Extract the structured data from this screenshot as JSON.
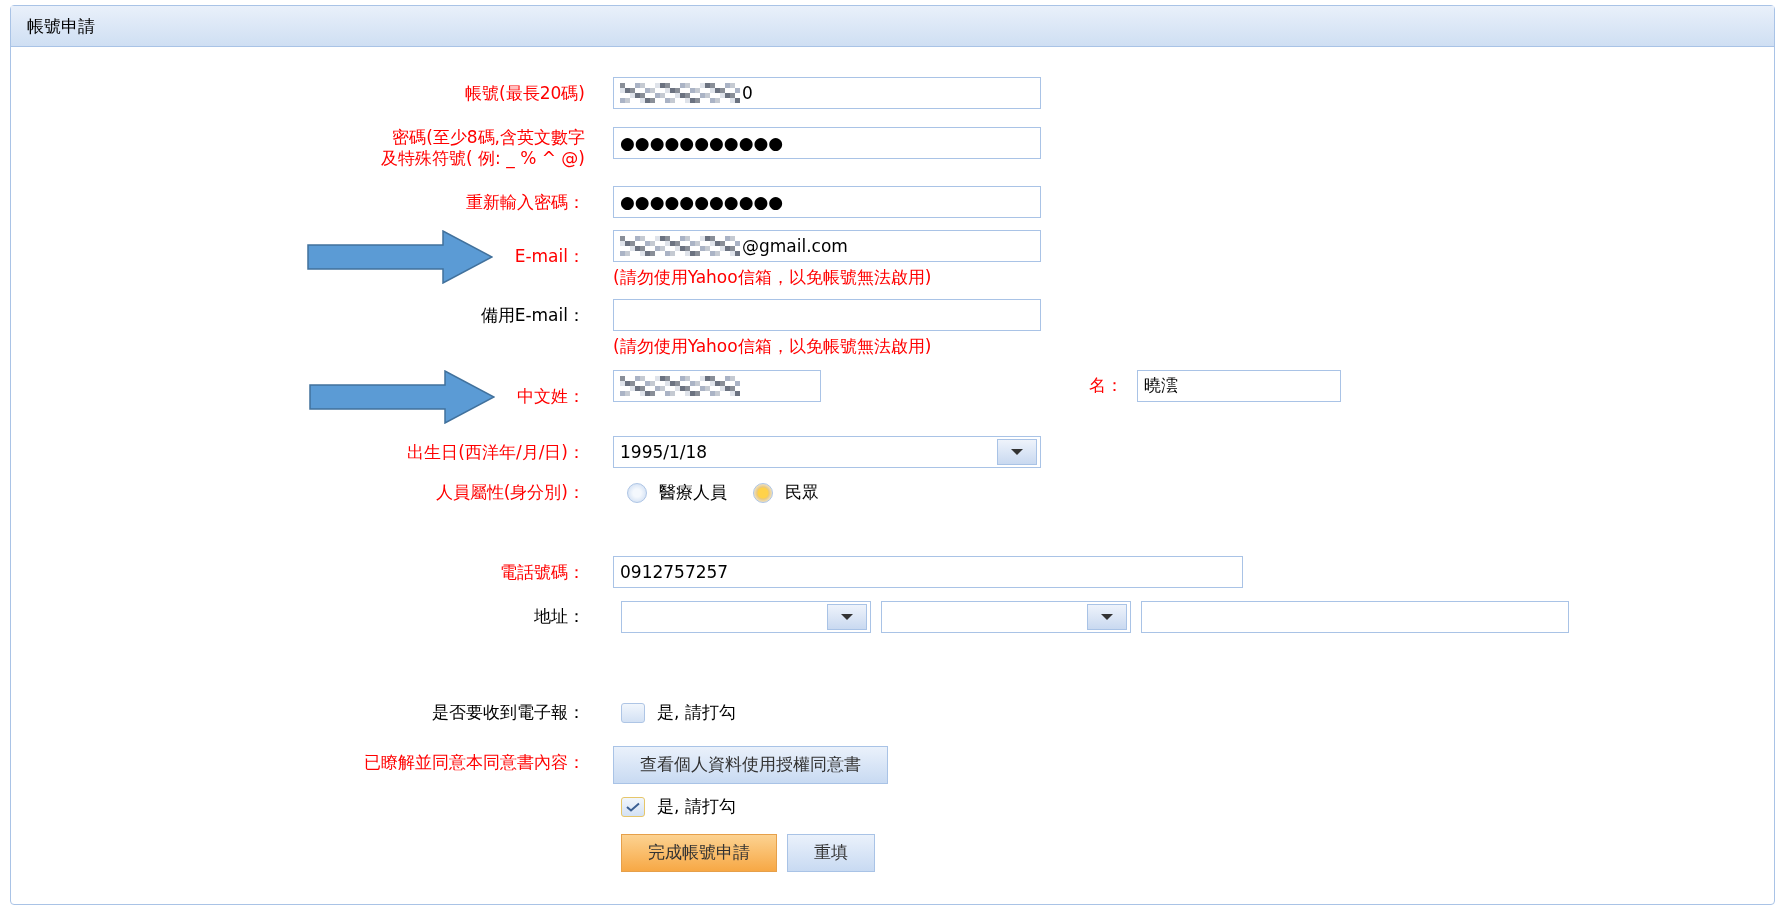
{
  "panel": {
    "title": "帳號申請"
  },
  "fields": [
    {
      "kind": "text",
      "label": "帳號(最長20碼)",
      "required": true,
      "arrow": false,
      "redacted": true,
      "value": "0"
    },
    {
      "kind": "text",
      "label": "密碼(至少8碼,含英文數字及特殊符號( 例: _ % ^ @)",
      "required": true,
      "arrow": false,
      "redacted": false,
      "value": "●●●●●●●●●●●"
    },
    {
      "kind": "text",
      "label": "重新輸入密碼：",
      "required": true,
      "arrow": false,
      "redacted": false,
      "value": "●●●●●●●●●●●"
    },
    {
      "kind": "email",
      "label": "E-mail：",
      "required": true,
      "arrow": true,
      "redacted": true,
      "value": "@gmail.com",
      "note": "(請勿使用Yahoo信箱，以免帳號無法啟用)"
    },
    {
      "kind": "email",
      "label": "備用E-mail：",
      "required": false,
      "arrow": false,
      "redacted": false,
      "note": "(請勿使用Yahoo信箱，以免帳號無法啟用)"
    },
    {
      "kind": "name",
      "label": "中文姓：",
      "required": true,
      "arrow": true,
      "redacted": true,
      "given_label": "名：",
      "given_value": "曉澐"
    },
    {
      "kind": "select",
      "label": "出生日(西洋年/月/日)：",
      "required": true,
      "arrow": false,
      "value": "1995/1/18"
    },
    {
      "kind": "radio",
      "label": "人員屬性(身分別)：",
      "required": true,
      "arrow": false,
      "options": [
        {
          "label": "醫療人員",
          "selected": false
        },
        {
          "label": "民眾",
          "selected": true
        }
      ]
    },
    {
      "kind": "phone",
      "label": "電話號碼：",
      "required": true,
      "arrow": false,
      "value": "0912757257"
    },
    {
      "kind": "address",
      "label": "地址：",
      "required": false,
      "arrow": false
    },
    {
      "kind": "checkbox",
      "label": "是否要收到電子報：",
      "required": false,
      "arrow": false,
      "option": "是, 請打勾",
      "checked": false
    },
    {
      "kind": "consent",
      "label": "已瞭解並同意本同意書內容：",
      "required": true,
      "arrow": false,
      "button": "查看個人資料使用授權同意書",
      "option": "是, 請打勾",
      "checked": true
    }
  ],
  "buttons": [
    {
      "label": "完成帳號申請",
      "primary": true
    },
    {
      "label": "重填",
      "primary": false
    }
  ]
}
